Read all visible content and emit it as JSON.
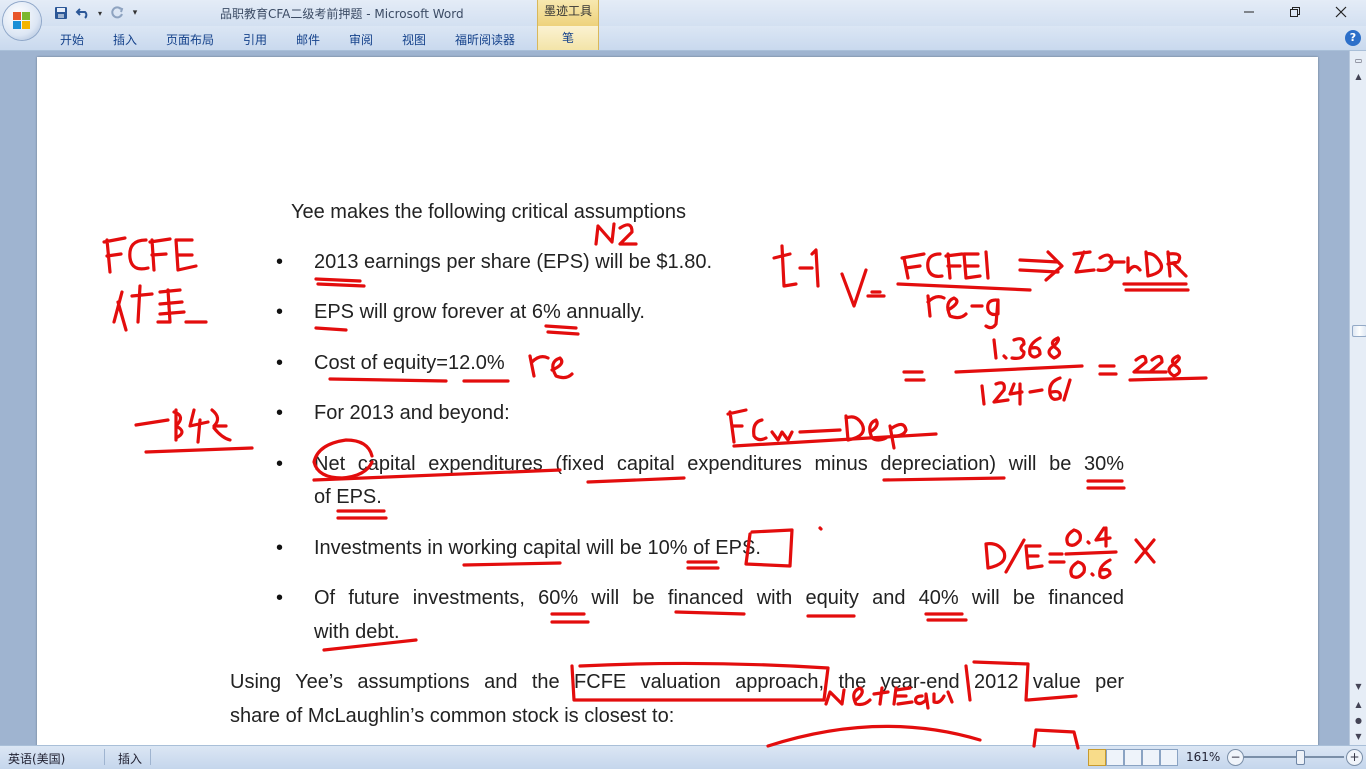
{
  "window": {
    "title": "品职教育CFA二级考前押题 - Microsoft Word",
    "context_tab": "墨迹工具"
  },
  "ribbon": {
    "tabs": [
      "开始",
      "插入",
      "页面布局",
      "引用",
      "邮件",
      "审阅",
      "视图",
      "福昕阅读器"
    ],
    "context_subtab": "笔"
  },
  "document": {
    "intro": "Yee makes the following critical assumptions",
    "bullets": [
      "2013 earnings per share (EPS) will be $1.80.",
      "EPS will grow forever at 6% annually.",
      "Cost of equity=12.0%",
      "For 2013 and beyond:",
      "Net capital expenditures (fixed capital expenditures minus depreciation) will be 30%",
      "of EPS.",
      "Investments in working capital will be 10% of EPS.",
      "Of future investments, 60% will be financed with equity and 40% will be financed",
      "with debt."
    ],
    "question_line1": "Using Yee’s assumptions and the FCFE valuation approach, the year-end 2012 value per",
    "question_line2": "share of McLaughlin’s common stock is closest to:"
  },
  "statusbar": {
    "language": "英语(美国)",
    "insert_mode": "插入",
    "zoom": "161%"
  }
}
